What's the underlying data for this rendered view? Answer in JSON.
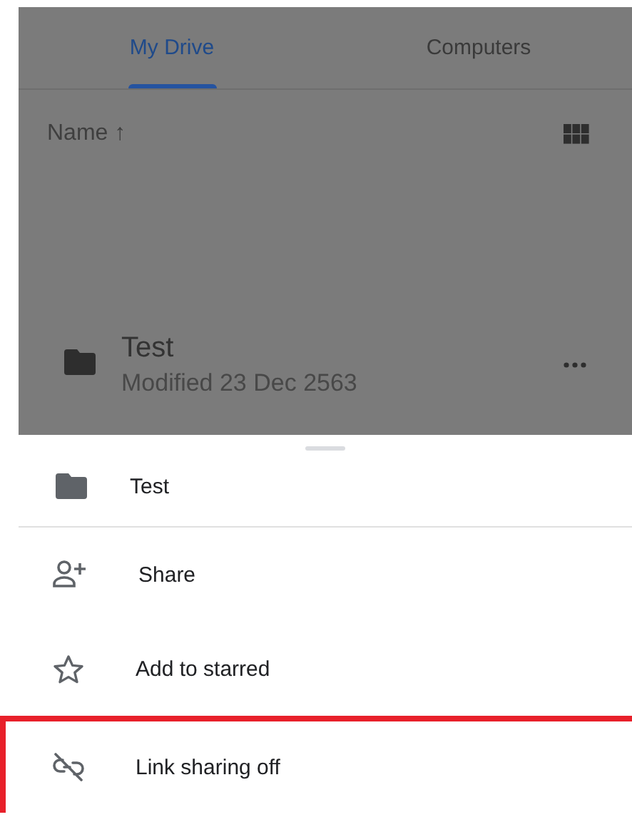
{
  "tabs": [
    {
      "label": "My Drive",
      "selected": true
    },
    {
      "label": "Computers",
      "selected": false
    }
  ],
  "sort": {
    "label": "Name",
    "arrow": "↑"
  },
  "files": [
    {
      "name": "Test",
      "modified": "Modified 23 Dec 2563"
    }
  ],
  "sheet": {
    "title": "Test",
    "items": [
      {
        "kind": "share",
        "label": "Share",
        "highlighted": false
      },
      {
        "kind": "star",
        "label": "Add to starred",
        "highlighted": false
      },
      {
        "kind": "link-off",
        "label": "Link sharing off",
        "highlighted": true
      }
    ]
  }
}
